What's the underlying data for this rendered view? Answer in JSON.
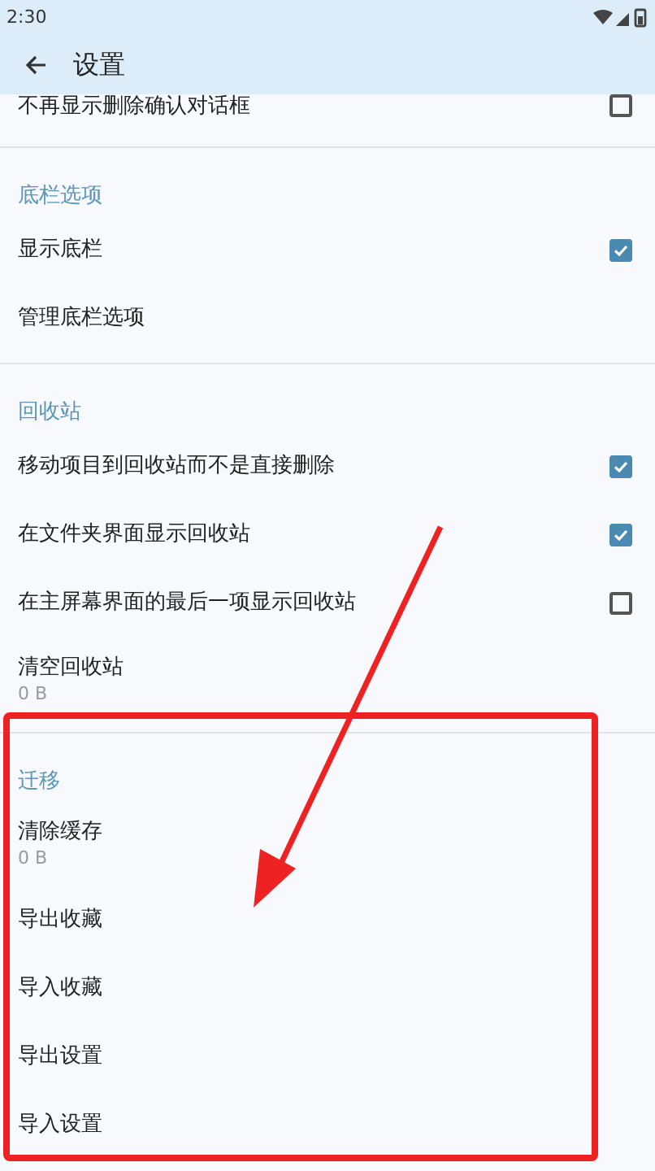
{
  "status_bar": {
    "time": "2:30"
  },
  "app_bar": {
    "title": "设置"
  },
  "sections": [
    {
      "items": [
        {
          "kind": "checkbox",
          "label": "不再显示删除确认对话框",
          "checked": false
        }
      ]
    },
    {
      "title": "底栏选项",
      "items": [
        {
          "kind": "checkbox",
          "label": "显示底栏",
          "checked": true
        },
        {
          "kind": "action",
          "label": "管理底栏选项"
        }
      ]
    },
    {
      "title": "回收站",
      "items": [
        {
          "kind": "checkbox",
          "label": "移动项目到回收站而不是直接删除",
          "checked": true
        },
        {
          "kind": "checkbox",
          "label": "在文件夹界面显示回收站",
          "checked": true
        },
        {
          "kind": "checkbox",
          "label": "在主屏幕界面的最后一项显示回收站",
          "checked": false
        },
        {
          "kind": "action",
          "label": "清空回收站",
          "subtitle": "0 B"
        }
      ]
    },
    {
      "title": "迁移",
      "items": [
        {
          "kind": "action",
          "label": "清除缓存",
          "subtitle": "0 B"
        },
        {
          "kind": "action",
          "label": "导出收藏"
        },
        {
          "kind": "action",
          "label": "导入收藏"
        },
        {
          "kind": "action",
          "label": "导出设置"
        },
        {
          "kind": "action",
          "label": "导入设置"
        }
      ]
    }
  ]
}
